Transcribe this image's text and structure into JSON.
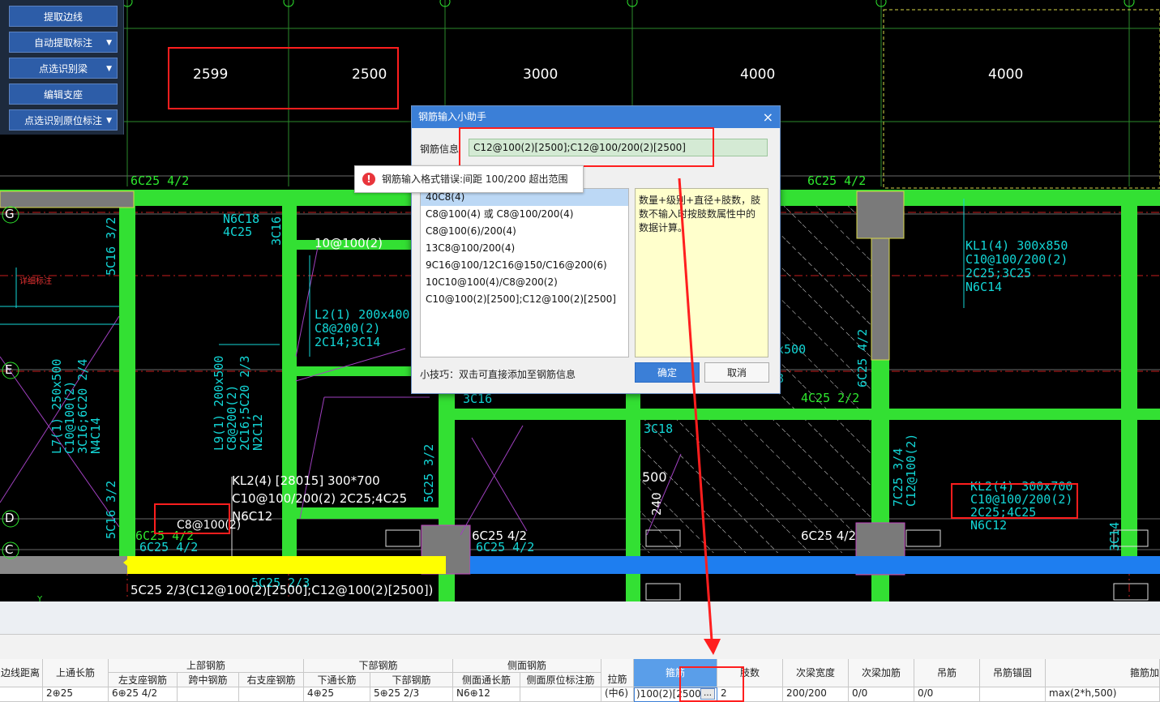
{
  "toolbar": {
    "buttons": [
      {
        "label": "提取边线",
        "dropdown": false
      },
      {
        "label": "自动提取标注",
        "dropdown": true
      },
      {
        "label": "点选识别梁",
        "dropdown": true
      },
      {
        "label": "编辑支座",
        "dropdown": false
      },
      {
        "label": "点选识别原位标注",
        "dropdown": true
      }
    ]
  },
  "drawing": {
    "dimensions": [
      "2599",
      "2500",
      "3000",
      "4000",
      "4000"
    ],
    "axis_labels": [
      "G",
      "E",
      "D",
      "C"
    ],
    "annotations": {
      "kl2_line1": "KL2(4) [28015] 300*700",
      "kl2_line2": "C10@100/200(2) 2C25;4C25",
      "kl2_line3": "N6C12",
      "stirrup_small": "C8@100(2)",
      "stirrup_top": "10@100(2)",
      "bottom_main": "5C25 2/3(C12@100(2)[2500];C12@100(2)[2500])",
      "bar_6c25_a": "6C25 4/2",
      "bar_6c25_b": "6C25 4/2",
      "bar_6c25_c": "6C25 4/2",
      "bar_6c25_top_left": "6C25 4/2",
      "bar_6c25_top_right": "6C25 4/2",
      "bar_6c25_d": "6C25 4/2",
      "bar_6c25_e": "6C25 4/2",
      "n6c18": "N6C18",
      "c4c25": "4C25",
      "c3c16": "3C16",
      "c5c16": "5C16 3/2",
      "l2_1": "L2(1) 200x400",
      "l2_2": "C8@200(2)",
      "l2_3": "2C14;3C14",
      "kl1_1": "KL1(4) 300x850",
      "kl1_2": "C10@100/200(2)",
      "kl1_3": "2C25;3C25",
      "kl1_4": "N6C14",
      "kl2r_1": "KL2(4) 300x700",
      "kl2r_2": "C10@100/200(2)",
      "kl2r_3": "2C25;4C25",
      "kl2r_4": "N6C12",
      "l7_1": "L7(1) 250x500",
      "l7_2": "C10@100(2)",
      "l7_3": "3C16;6C20 2/4",
      "l7_4": "N4C14",
      "l9_1": "L9(1) 200x500",
      "l9_2": "C8@200(2)",
      "l9_3": "2C16;5C20 2/3",
      "l9_4": "N2C12",
      "c4c25_2": "4C25 2/2",
      "c6c25_42v": "6C25 4/2",
      "c7c25": "7C25 3/4",
      "c12": "C12@100(2)",
      "x500": "x500",
      "n8": "8",
      "c3c16b": "3C16",
      "c3c18": "3C18",
      "dim500": "500",
      "dim240": "240",
      "c5c25v": "5C25 3/2",
      "c5c25h": "5C25 2/3",
      "c5c16b": "5C16 3/2",
      "c3c14": "3C14",
      "small_red": "详细标注",
      "ytick": "Y"
    }
  },
  "dialog": {
    "title": "钢筋输入小助手",
    "close": "×",
    "info_label": "钢筋信息",
    "info_value": "C12@100(2)[2500];C12@100/200(2)[2500]",
    "examples": [
      "40C8(4)",
      "C8@100(4) 或 C8@100/200(4)",
      "C8@100(6)/200(4)",
      "13C8@100/200(4)",
      "9C16@100/12C16@150/C16@200(6)",
      "10C10@100(4)/C8@200(2)",
      "C10@100(2)[2500];C12@100(2)[2500]"
    ],
    "selected_index": 0,
    "hint": "数量+级别+直径+肢数，肢数不输入时按肢数属性中的数据计算。",
    "tip": "小技巧：双击可直接添加至钢筋信息",
    "ok": "确定",
    "cancel": "取消"
  },
  "error": {
    "icon": "error-icon",
    "message": "钢筋输入格式错误:间距 100/200 超出范围"
  },
  "table": {
    "group_headers": {
      "upper": "上部钢筋",
      "lower": "下部钢筋",
      "side": "侧面钢筋"
    },
    "headers": {
      "edge_dist": "边线距离",
      "top_long": "上通长筋",
      "left_seat": "左支座钢筋",
      "mid_span": "跨中钢筋",
      "right_seat": "右支座钢筋",
      "bot_long": "下通长筋",
      "bot_bar": "下部钢筋",
      "side_long": "侧面通长筋",
      "side_orig": "侧面原位标注筋",
      "tie": "拉筋",
      "stirrup": "箍筋",
      "legs": "肢数",
      "sec_width": "次梁宽度",
      "sec_add": "次梁加筋",
      "hanger": "吊筋",
      "hanger_anchor": "吊筋锚固",
      "stirrup_add": "箍筋加"
    },
    "row": {
      "top_long": "2⊕25",
      "left_seat": "6⊕25 4/2",
      "mid_span": "",
      "right_seat": "",
      "bot_long": "4⊕25",
      "bot_bar": "5⊕25 2/3",
      "side_long": "N6⊕12",
      "side_orig": "",
      "tie": "(中6)",
      "stirrup": ")100(2)[2500]",
      "stirrup_btn": "…",
      "legs": "2",
      "sec_width": "200/200",
      "sec_add": "0/0",
      "hanger": "0/0",
      "hanger_anchor": "",
      "stirrup_add": "max(2*h,500)"
    }
  }
}
